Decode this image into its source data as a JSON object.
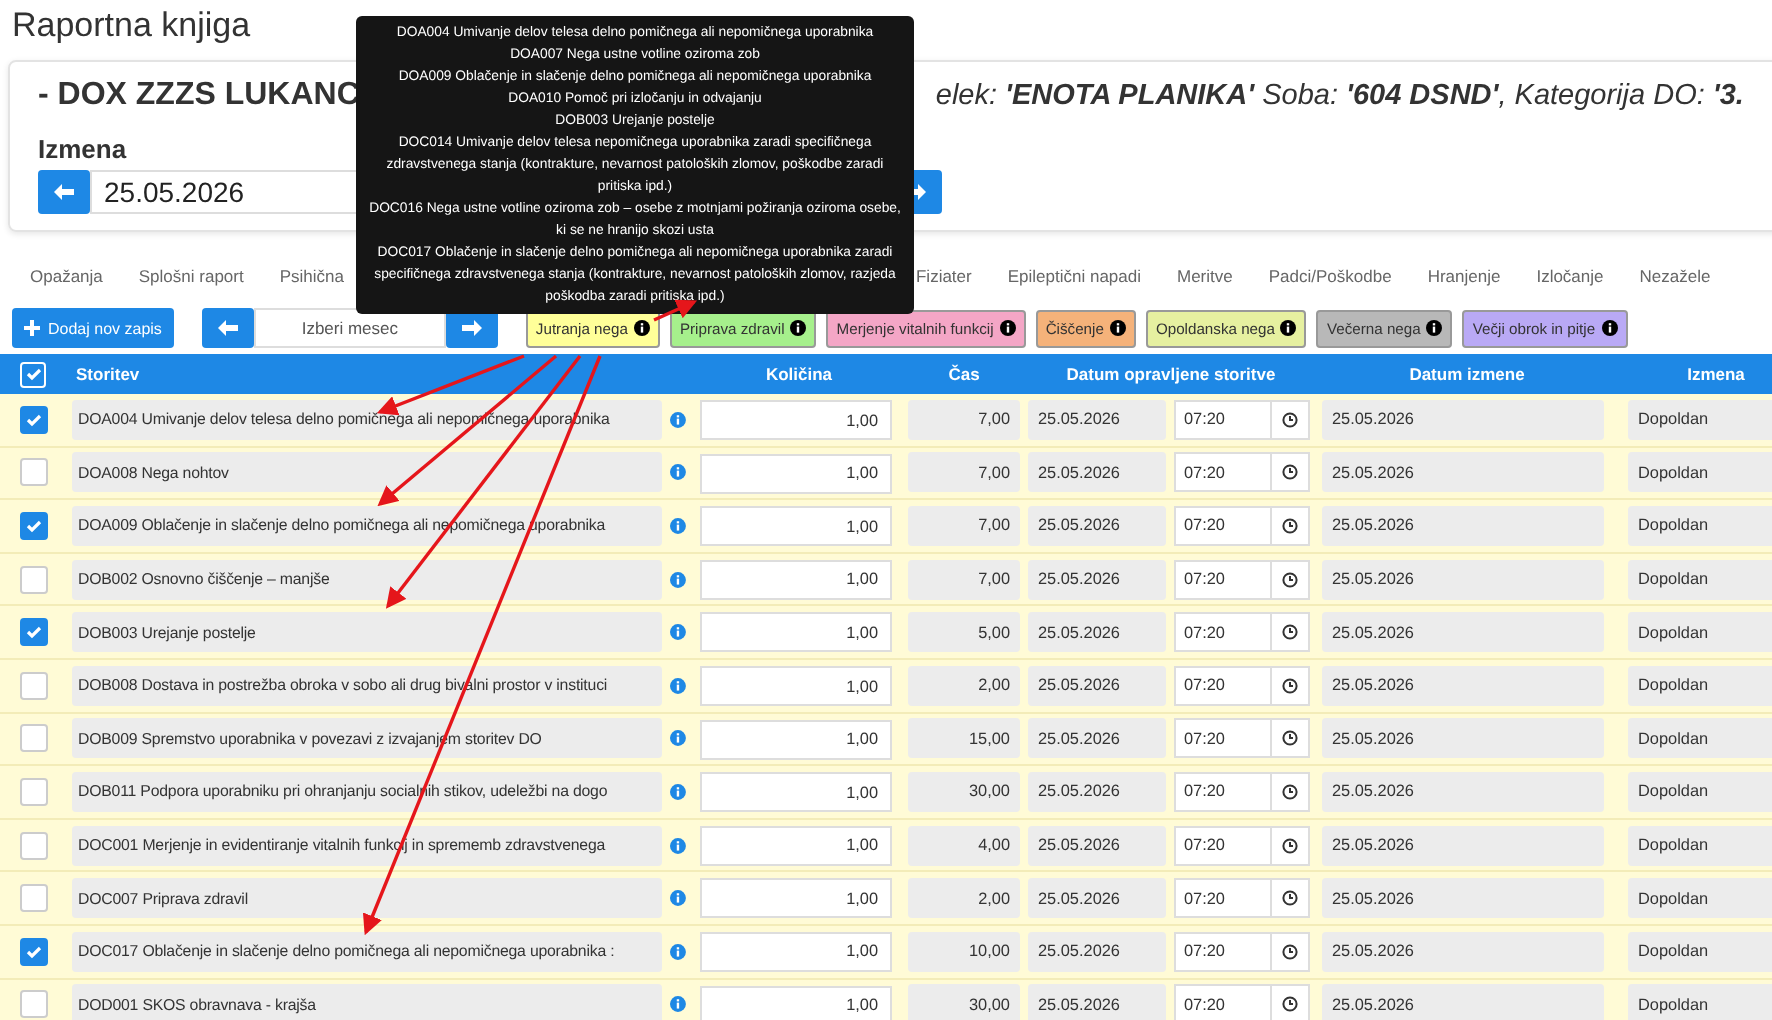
{
  "page_title": "Raportna knjiga",
  "patient": {
    "name": "- DOX ZZZS LUKANC",
    "details": "elek: **'ENOTA PLANIKA'** Soba: **'604 DSND'**, Kategorija DO: **'3.**"
  },
  "shift": {
    "label": "Izmena",
    "date": "25.05.2026"
  },
  "tabs": [
    {
      "label": "Opažanja",
      "selected": false
    },
    {
      "label": "Splošni raport",
      "selected": false
    },
    {
      "label": "Psihična",
      "selected": false
    },
    {
      "label": "Fiziater",
      "selected": false
    },
    {
      "label": "Epileptični napadi",
      "selected": false
    },
    {
      "label": "Meritve",
      "selected": false
    },
    {
      "label": "Padci/Poškodbe",
      "selected": false
    },
    {
      "label": "Hranjenje",
      "selected": false
    },
    {
      "label": "Izločanje",
      "selected": false
    },
    {
      "label": "Nezažele",
      "selected": false
    }
  ],
  "tooltip": {
    "lines": [
      "DOA004 Umivanje delov telesa delno pomičnega ali nepomičnega uporabnika",
      "DOA007 Nega ustne votline oziroma zob",
      "DOA009 Oblačenje in slačenje delno pomičnega ali nepomičnega uporabnika",
      "DOA010 Pomoč pri izločanju in odvajanju",
      "DOB003 Urejanje postelje",
      "DOC014 Umivanje delov telesa nepomičnega uporabnika zaradi specifičnega zdravstvenega stanja (kontrakture, nevarnost patoloških zlomov, poškodbe zaradi pritiska ipd.)",
      "DOC016 Nega ustne votline oziroma zob – osebe z motnjami požiranja oziroma osebe, ki se ne hranijo skozi usta",
      "DOC017 Oblačenje in slačenje delno pomičnega ali nepomičnega uporabnika zaradi specifičnega zdravstvenega stanja (kontrakture, nevarnost patoloških zlomov, razjeda poškodba zaradi pritiska ipd.)"
    ]
  },
  "toolbar": {
    "add_button": "Dodaj nov zapis",
    "month_placeholder": "Izberi mesec"
  },
  "filters": [
    {
      "label": "Jutranja nega",
      "color": "#ffff99"
    },
    {
      "label": "Priprava zdravil",
      "color": "#a6f08c"
    },
    {
      "label": "Merjenje vitalnih funkcij",
      "color": "#f4a6c6"
    },
    {
      "label": "Čiščenje",
      "color": "#f5b27a"
    },
    {
      "label": "Opoldanska nega",
      "color": "#e6f0a0"
    },
    {
      "label": "Večerna nega",
      "color": "#b8b8b8"
    },
    {
      "label": "Večji obrok in pitje",
      "color": "#b9a9f5"
    }
  ],
  "table": {
    "select_all_checked": true,
    "columns": [
      "Storitev",
      "Količina",
      "Čas",
      "Datum opravljene storitve",
      "Datum izmene",
      "Izmena"
    ],
    "rows": [
      {
        "checked": true,
        "service": "DOA004 Umivanje delov telesa delno pomičnega ali nepomičnega uporabnika",
        "quantity": "1,00",
        "time": "7,00",
        "date": "25.05.2026",
        "clock": "07:20",
        "shift_date": "25.05.2026",
        "shift": "Dopoldan"
      },
      {
        "checked": false,
        "service": "DOA008 Nega nohtov",
        "quantity": "1,00",
        "time": "7,00",
        "date": "25.05.2026",
        "clock": "07:20",
        "shift_date": "25.05.2026",
        "shift": "Dopoldan"
      },
      {
        "checked": true,
        "service": "DOA009 Oblačenje in slačenje delno pomičnega ali nepomičnega uporabnika",
        "quantity": "1,00",
        "time": "7,00",
        "date": "25.05.2026",
        "clock": "07:20",
        "shift_date": "25.05.2026",
        "shift": "Dopoldan"
      },
      {
        "checked": false,
        "service": "DOB002 Osnovno čiščenje – manjše",
        "quantity": "1,00",
        "time": "7,00",
        "date": "25.05.2026",
        "clock": "07:20",
        "shift_date": "25.05.2026",
        "shift": "Dopoldan"
      },
      {
        "checked": true,
        "service": "DOB003 Urejanje postelje",
        "quantity": "1,00",
        "time": "5,00",
        "date": "25.05.2026",
        "clock": "07:20",
        "shift_date": "25.05.2026",
        "shift": "Dopoldan"
      },
      {
        "checked": false,
        "service": "DOB008 Dostava in postrežba obroka v sobo ali drug bivalni prostor v instituci",
        "quantity": "1,00",
        "time": "2,00",
        "date": "25.05.2026",
        "clock": "07:20",
        "shift_date": "25.05.2026",
        "shift": "Dopoldan"
      },
      {
        "checked": false,
        "service": "DOB009 Spremstvo uporabnika v povezavi z izvajanjem storitev DO",
        "quantity": "1,00",
        "time": "15,00",
        "date": "25.05.2026",
        "clock": "07:20",
        "shift_date": "25.05.2026",
        "shift": "Dopoldan"
      },
      {
        "checked": false,
        "service": "DOB011 Podpora uporabniku pri ohranjanju socialnih stikov, udeležbi na dogo",
        "quantity": "1,00",
        "time": "30,00",
        "date": "25.05.2026",
        "clock": "07:20",
        "shift_date": "25.05.2026",
        "shift": "Dopoldan"
      },
      {
        "checked": false,
        "service": "DOC001 Merjenje in evidentiranje vitalnih funkcij in sprememb zdravstvenega",
        "quantity": "1,00",
        "time": "4,00",
        "date": "25.05.2026",
        "clock": "07:20",
        "shift_date": "25.05.2026",
        "shift": "Dopoldan"
      },
      {
        "checked": false,
        "service": "DOC007 Priprava zdravil",
        "quantity": "1,00",
        "time": "2,00",
        "date": "25.05.2026",
        "clock": "07:20",
        "shift_date": "25.05.2026",
        "shift": "Dopoldan"
      },
      {
        "checked": true,
        "service": "DOC017 Oblačenje in slačenje delno pomičnega ali nepomičnega uporabnika :",
        "quantity": "1,00",
        "time": "10,00",
        "date": "25.05.2026",
        "clock": "07:20",
        "shift_date": "25.05.2026",
        "shift": "Dopoldan"
      },
      {
        "checked": false,
        "service": "DOD001 SKOS obravnava - krajša",
        "quantity": "1,00",
        "time": "30,00",
        "date": "25.05.2026",
        "clock": "07:20",
        "shift_date": "25.05.2026",
        "shift": "Dopoldan"
      }
    ]
  }
}
